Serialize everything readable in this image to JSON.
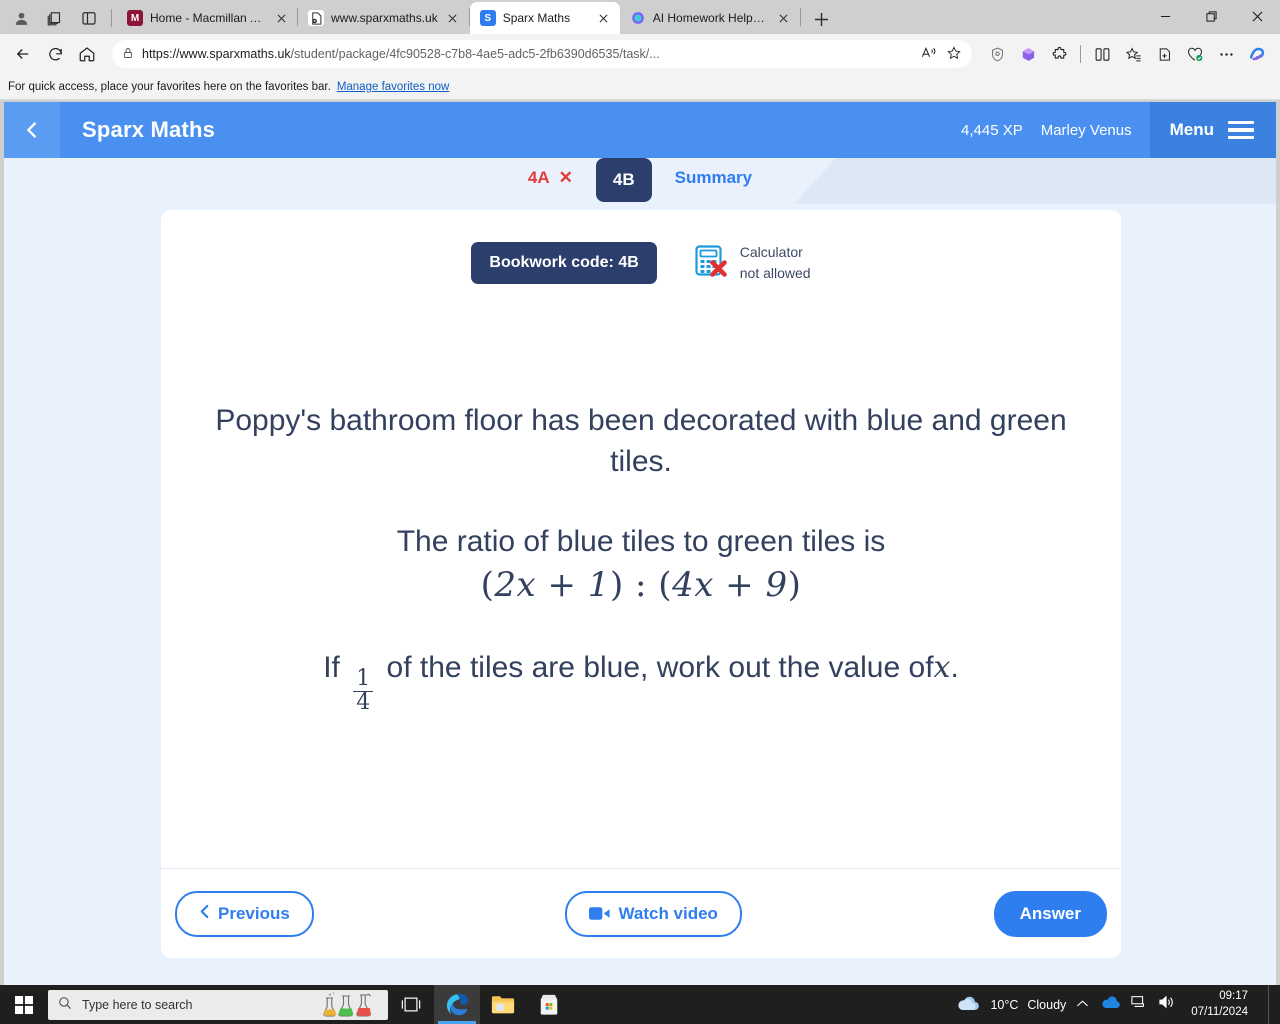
{
  "browser": {
    "profile_icon": "person-icon",
    "collections_icon": "collections-icon",
    "split_icon": "tab-panel-icon",
    "tabs": [
      {
        "title": "Home - Macmillan Academy",
        "favicon_letter": "M",
        "favicon_color": "#8a1538",
        "active": false
      },
      {
        "title": "www.sparxmaths.uk",
        "favicon_letter": "",
        "favicon_color": "#ffffff",
        "active": false
      },
      {
        "title": "Sparx Maths",
        "favicon_letter": "S",
        "favicon_color": "#2f7ef0",
        "active": true
      },
      {
        "title": "AI Homework Helper & Solver -",
        "favicon_letter": "",
        "favicon_color": "#7b61ff",
        "active": false
      }
    ],
    "new_tab_label": "+",
    "window_controls": {
      "minimize": "−",
      "maximize": "❐",
      "close": "✕"
    },
    "nav": {
      "back": "back-arrow",
      "refresh": "refresh",
      "home": "home"
    },
    "address": {
      "lock": "lock-icon",
      "url_bold": "https://www.sparxmaths.uk",
      "url_rest": "/student/package/4fc90528-c7b8-4ae5-adc5-2fb6390d6535/task/...",
      "read_aloud": "read-aloud-icon",
      "favorite": "star-icon"
    },
    "toolbar_right": [
      "shield-icon",
      "copilot-icon",
      "extensions-icon",
      "split-screen-icon",
      "favorites-icon",
      "collections-icon",
      "browser-essentials-icon",
      "settings-more-icon",
      "copilot-sidebar-icon"
    ],
    "favorites_bar": {
      "message": "For quick access, place your favorites here on the favorites bar.",
      "link": "Manage favorites now"
    }
  },
  "app": {
    "back_icon": "chevron-left-icon",
    "brand": "Sparx Maths",
    "xp": "4,445 XP",
    "user": "Marley Venus",
    "menu_label": "Menu",
    "menu_icon": "hamburger-icon",
    "question_tabs": [
      {
        "label": "4A",
        "state": "incorrect",
        "mark": "✕"
      },
      {
        "label": "4B",
        "state": "current",
        "mark": ""
      },
      {
        "label": "Summary",
        "state": "link",
        "mark": ""
      }
    ],
    "bookwork_code": "Bookwork code: 4B",
    "calculator": {
      "icon": "calculator-not-allowed-icon",
      "line1": "Calculator",
      "line2": "not allowed"
    },
    "question": {
      "line1": "Poppy's bathroom floor has been decorated with blue and green tiles.",
      "line2": "The ratio of blue tiles to green tiles is",
      "ratio_left_open": "(",
      "ratio_left": "2x + 1",
      "ratio_left_close": ")",
      "ratio_colon": ":",
      "ratio_right_open": "(",
      "ratio_right": "4x + 9",
      "ratio_right_close": ")",
      "line3_before": "If",
      "fraction_numerator": "1",
      "fraction_denominator": "4",
      "line3_after": "of the tiles are blue, work out the value of",
      "line3_variable": "x",
      "line3_end": "."
    },
    "footer": {
      "previous_label": "Previous",
      "previous_icon": "chevron-left-icon",
      "watch_video_label": "Watch video",
      "watch_video_icon": "video-camera-icon",
      "answer_label": "Answer"
    },
    "colors": {
      "header_blue": "#4a90f0",
      "menu_blue": "#3b82e0",
      "accent_blue": "#2f7ef0",
      "navy": "#2c3e6b",
      "page_bg": "#e9f1fd",
      "incorrect_red": "#e23b3b"
    }
  },
  "taskbar": {
    "start_icon": "windows-start-icon",
    "search_placeholder": "Type here to search",
    "search_icon": "magnifier-icon",
    "task_view_icon": "task-view-icon",
    "pinned": [
      "edge-icon",
      "file-explorer-icon",
      "microsoft-store-icon"
    ],
    "weather_temp": "10°C",
    "weather_desc": "Cloudy",
    "tray_icons": [
      "chevron-up-icon",
      "onedrive-icon",
      "network-icon",
      "volume-icon"
    ],
    "time": "09:17",
    "date": "07/11/2024"
  }
}
